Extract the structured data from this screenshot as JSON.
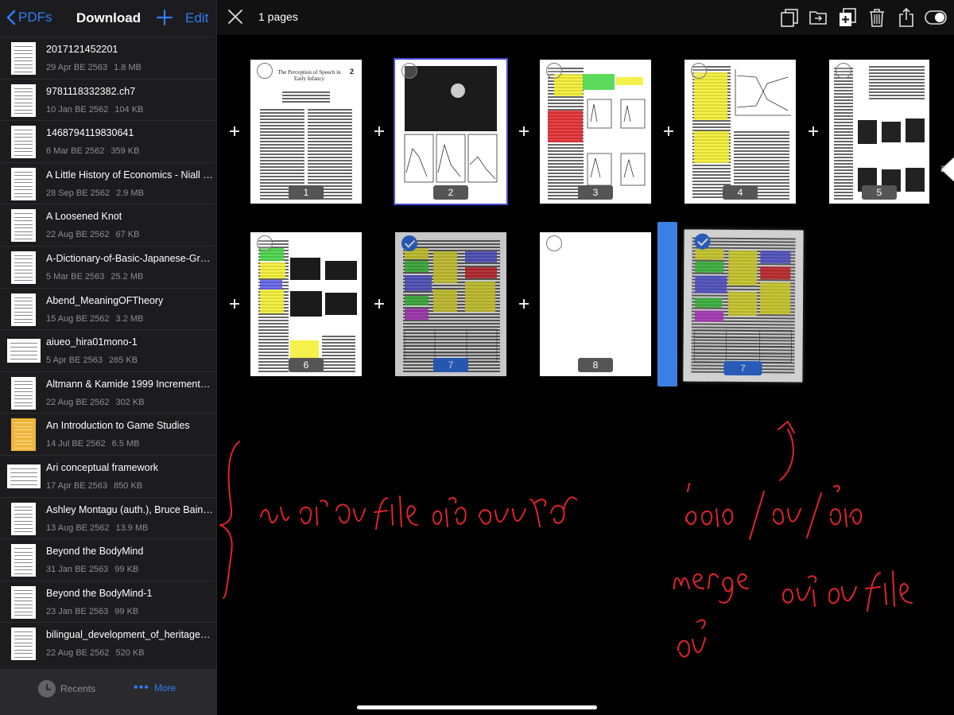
{
  "sidebar": {
    "back_label": "PDFs",
    "title": "Download",
    "edit_label": "Edit",
    "files": [
      {
        "name": "2017121452201",
        "date": "29 Apr BE 2563",
        "size": "1.8 MB"
      },
      {
        "name": "9781118332382.ch7",
        "date": "10 Jan BE 2562",
        "size": "104 KB"
      },
      {
        "name": "1468794119830641",
        "date": "6 Mar BE 2562",
        "size": "359 KB"
      },
      {
        "name": "A Little History of Economics - Niall Ki…",
        "date": "28 Sep BE 2562",
        "size": "2.9 MB"
      },
      {
        "name": "A Loosened Knot",
        "date": "22 Aug BE 2562",
        "size": "67 KB"
      },
      {
        "name": "A-Dictionary-of-Basic-Japanese-Gram…",
        "date": "5 Mar BE 2563",
        "size": "25.2 MB"
      },
      {
        "name": "Abend_MeaningOFTheory",
        "date": "15 Aug BE 2562",
        "size": "3.2 MB"
      },
      {
        "name": "aiueo_hira01mono-1",
        "date": "5 Apr BE 2563",
        "size": "265 KB"
      },
      {
        "name": "Altmann & Kamide 1999 Incremental i…",
        "date": "22 Aug BE 2562",
        "size": "302 KB"
      },
      {
        "name": "An Introduction to Game Studies",
        "date": "14 Jul BE 2562",
        "size": "6.5 MB"
      },
      {
        "name": "Ari conceptual framework",
        "date": "17 Apr BE 2563",
        "size": "850 KB"
      },
      {
        "name": "Ashley Montagu (auth.), Bruce Bain (e…",
        "date": "13 Aug BE 2562",
        "size": "13.9 MB"
      },
      {
        "name": "Beyond the BodyMind",
        "date": "31 Jan BE 2563",
        "size": "99 KB"
      },
      {
        "name": "Beyond the BodyMind-1",
        "date": "23 Jan BE 2563",
        "size": "99 KB"
      },
      {
        "name": "bilingual_development_of_heritage_spe…",
        "date": "22 Aug BE 2562",
        "size": "520 KB"
      }
    ],
    "footer": {
      "recents_label": "Recents",
      "more_label": "More"
    }
  },
  "topbar": {
    "pages_label": "1 pages",
    "icons": [
      "duplicate-icon",
      "move-to-folder-icon",
      "add-page-icon",
      "trash-icon",
      "share-icon",
      "toggle-icon"
    ]
  },
  "pages": [
    {
      "label": "1",
      "state": "unchecked",
      "title": "The Perception of Speech in Early Infancy",
      "page_no": "2"
    },
    {
      "label": "2",
      "state": "unchecked"
    },
    {
      "label": "3",
      "state": "unchecked"
    },
    {
      "label": "4",
      "state": "unchecked"
    },
    {
      "label": "5",
      "state": "unchecked"
    },
    {
      "label": "6",
      "state": "unchecked"
    },
    {
      "label": "7",
      "state": "checked"
    },
    {
      "label": "8",
      "state": "unchecked"
    }
  ],
  "dragging_page": {
    "label": "7",
    "state": "checked"
  },
  "side_tab_label": "2",
  "colors": {
    "accent": "#2f7cf6",
    "check": "#2f6fe0",
    "drop_indicator": "#3d7fe0",
    "annotation": "#e0242a",
    "yellow": "#f2ee2a",
    "green": "#3ed43e",
    "red": "#e2262a",
    "blue": "#5a5ae8",
    "magenta": "#c63ad8"
  }
}
